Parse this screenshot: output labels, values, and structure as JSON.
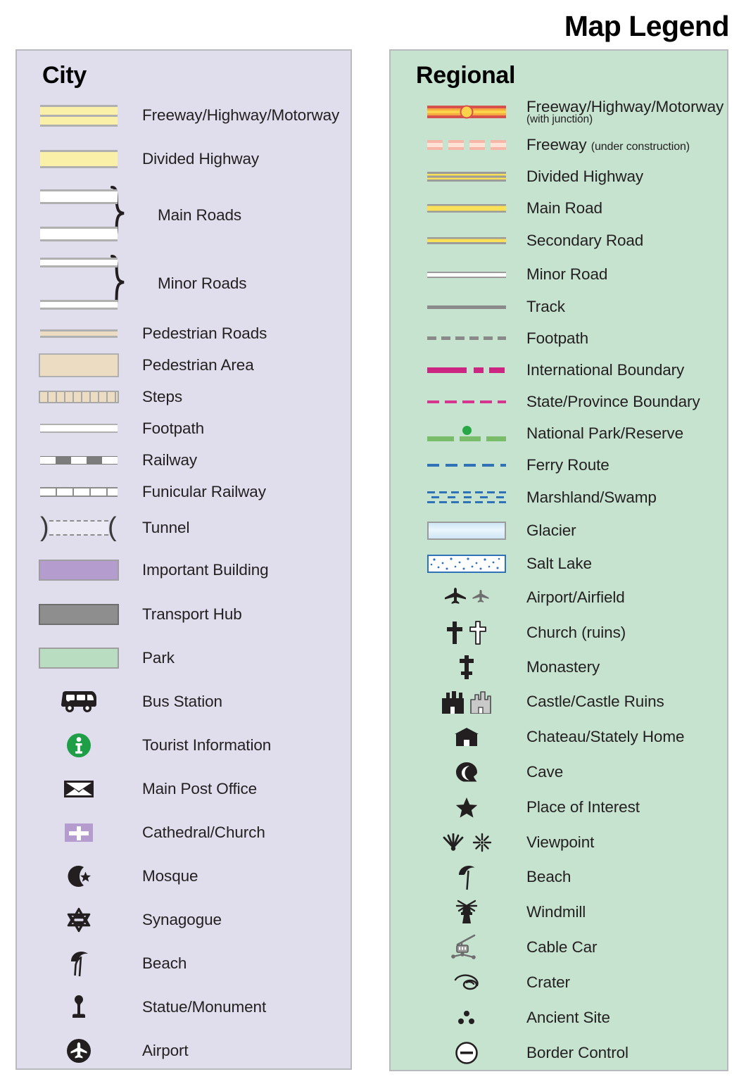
{
  "title": "Map Legend",
  "panels": {
    "city": {
      "heading": "City",
      "bg": "#E0DEEC",
      "items": [
        {
          "key": "freeway",
          "label": "Freeway/Highway/Motorway",
          "symbol": "city-freeway-swatch"
        },
        {
          "key": "divided",
          "label": "Divided Highway",
          "symbol": "city-divided-highway-swatch"
        },
        {
          "key": "main_roads",
          "label": "Main Roads",
          "symbol": "city-main-roads-swatch"
        },
        {
          "key": "minor_roads",
          "label": "Minor Roads",
          "symbol": "city-minor-roads-swatch"
        },
        {
          "key": "ped_roads",
          "label": "Pedestrian Roads",
          "symbol": "city-pedestrian-road-swatch"
        },
        {
          "key": "ped_area",
          "label": "Pedestrian Area",
          "symbol": "city-pedestrian-area-swatch"
        },
        {
          "key": "steps",
          "label": "Steps",
          "symbol": "city-steps-swatch"
        },
        {
          "key": "footpath",
          "label": "Footpath",
          "symbol": "city-footpath-swatch"
        },
        {
          "key": "railway",
          "label": "Railway",
          "symbol": "city-railway-swatch"
        },
        {
          "key": "funicular",
          "label": "Funicular Railway",
          "symbol": "city-funicular-swatch"
        },
        {
          "key": "tunnel",
          "label": "Tunnel",
          "symbol": "city-tunnel-swatch"
        },
        {
          "key": "important_bld",
          "label": "Important Building",
          "symbol": "city-important-building-swatch"
        },
        {
          "key": "transport_hub",
          "label": "Transport Hub",
          "symbol": "city-transport-hub-swatch"
        },
        {
          "key": "park",
          "label": "Park",
          "symbol": "city-park-swatch"
        },
        {
          "key": "bus_station",
          "label": "Bus Station",
          "symbol": "bus-icon"
        },
        {
          "key": "tourist_info",
          "label": "Tourist Information",
          "symbol": "info-circle-icon"
        },
        {
          "key": "post_office",
          "label": "Main Post Office",
          "symbol": "envelope-icon"
        },
        {
          "key": "cathedral",
          "label": "Cathedral/Church",
          "symbol": "church-block-icon"
        },
        {
          "key": "mosque",
          "label": "Mosque",
          "symbol": "crescent-star-icon"
        },
        {
          "key": "synagogue",
          "label": "Synagogue",
          "symbol": "star-of-david-icon"
        },
        {
          "key": "beach",
          "label": "Beach",
          "symbol": "parasol-icon"
        },
        {
          "key": "statue",
          "label": "Statue/Monument",
          "symbol": "statue-icon"
        },
        {
          "key": "airport",
          "label": "Airport",
          "symbol": "airplane-circle-icon"
        }
      ],
      "swatch_colors": {
        "freeway_fill": "#FBF0A8",
        "divided_fill": "#FBF0A8",
        "road_casing": "#B0B0B0",
        "main_road_fill": "#FFFFFF",
        "pedestrian_fill": "#ECDCC2",
        "railway_dark": "#7C7C7C",
        "important_building": "#B49CCF",
        "transport_hub": "#8E8E8E",
        "park": "#B9DDC0",
        "tourist_info_green": "#1E9E46"
      }
    },
    "regional": {
      "heading": "Regional",
      "bg": "#C6E3CF",
      "items": [
        {
          "key": "freeway",
          "label": "Freeway/Highway/Motorway",
          "sublabel": "(with junction)",
          "sub_style": "block",
          "symbol": "regional-freeway-swatch"
        },
        {
          "key": "freeway_uc",
          "label": "Freeway",
          "sublabel": "(under construction)",
          "sub_style": "inline",
          "symbol": "regional-freeway-construction-swatch"
        },
        {
          "key": "divided",
          "label": "Divided Highway",
          "symbol": "regional-divided-highway-swatch"
        },
        {
          "key": "main_road",
          "label": "Main Road",
          "symbol": "regional-main-road-swatch"
        },
        {
          "key": "secondary_road",
          "label": "Secondary Road",
          "symbol": "regional-secondary-road-swatch"
        },
        {
          "key": "minor_road",
          "label": "Minor Road",
          "symbol": "regional-minor-road-swatch"
        },
        {
          "key": "track",
          "label": "Track",
          "symbol": "regional-track-swatch"
        },
        {
          "key": "footpath",
          "label": "Footpath",
          "symbol": "regional-footpath-swatch"
        },
        {
          "key": "intl_boundary",
          "label": "International Boundary",
          "symbol": "international-boundary-swatch"
        },
        {
          "key": "state_boundary",
          "label": "State/Province Boundary",
          "symbol": "state-boundary-swatch"
        },
        {
          "key": "national_park",
          "label": "National Park/Reserve",
          "symbol": "national-park-swatch"
        },
        {
          "key": "ferry",
          "label": "Ferry Route",
          "symbol": "ferry-route-swatch"
        },
        {
          "key": "marshland",
          "label": "Marshland/Swamp",
          "symbol": "marshland-swatch"
        },
        {
          "key": "glacier",
          "label": "Glacier",
          "symbol": "glacier-swatch"
        },
        {
          "key": "salt_lake",
          "label": "Salt Lake",
          "symbol": "salt-lake-swatch"
        },
        {
          "key": "airport",
          "label": "Airport/Airfield",
          "symbol": "airplane-pair-icon"
        },
        {
          "key": "church_ruins",
          "label": "Church (ruins)",
          "symbol": "cross-pair-icon"
        },
        {
          "key": "monastery",
          "label": "Monastery",
          "symbol": "monastery-cross-icon"
        },
        {
          "key": "castle",
          "label": "Castle/Castle Ruins",
          "symbol": "castle-pair-icon"
        },
        {
          "key": "chateau",
          "label": "Chateau/Stately Home",
          "symbol": "chateau-icon"
        },
        {
          "key": "cave",
          "label": "Cave",
          "symbol": "cave-icon"
        },
        {
          "key": "place_interest",
          "label": "Place of Interest",
          "symbol": "star-icon"
        },
        {
          "key": "viewpoint",
          "label": "Viewpoint",
          "symbol": "viewpoint-pair-icon"
        },
        {
          "key": "beach",
          "label": "Beach",
          "symbol": "parasol-icon"
        },
        {
          "key": "windmill",
          "label": "Windmill",
          "symbol": "windmill-icon"
        },
        {
          "key": "cable_car",
          "label": "Cable Car",
          "symbol": "cable-car-icon"
        },
        {
          "key": "crater",
          "label": "Crater",
          "symbol": "crater-icon"
        },
        {
          "key": "ancient_site",
          "label": "Ancient Site",
          "symbol": "three-dots-icon"
        },
        {
          "key": "border_control",
          "label": "Border Control",
          "symbol": "border-control-icon"
        }
      ],
      "swatch_colors": {
        "freeway_casing": "#D6504C",
        "freeway_fill": "#FBD34A",
        "freeway_mid": "#F5A93F",
        "construction_light": "#FDE2D5",
        "construction_dark": "#F7B6A8",
        "road_yellow": "#FBE158",
        "road_casing": "#9B9B9B",
        "track_gray": "#8A8A8A",
        "intl_boundary": "#CC2682",
        "state_boundary": "#D6348F",
        "park_green": "#79BD6A",
        "park_dot": "#27A745",
        "water_blue": "#2F72B8",
        "glacier_fill": "#CFE6F6"
      }
    }
  }
}
